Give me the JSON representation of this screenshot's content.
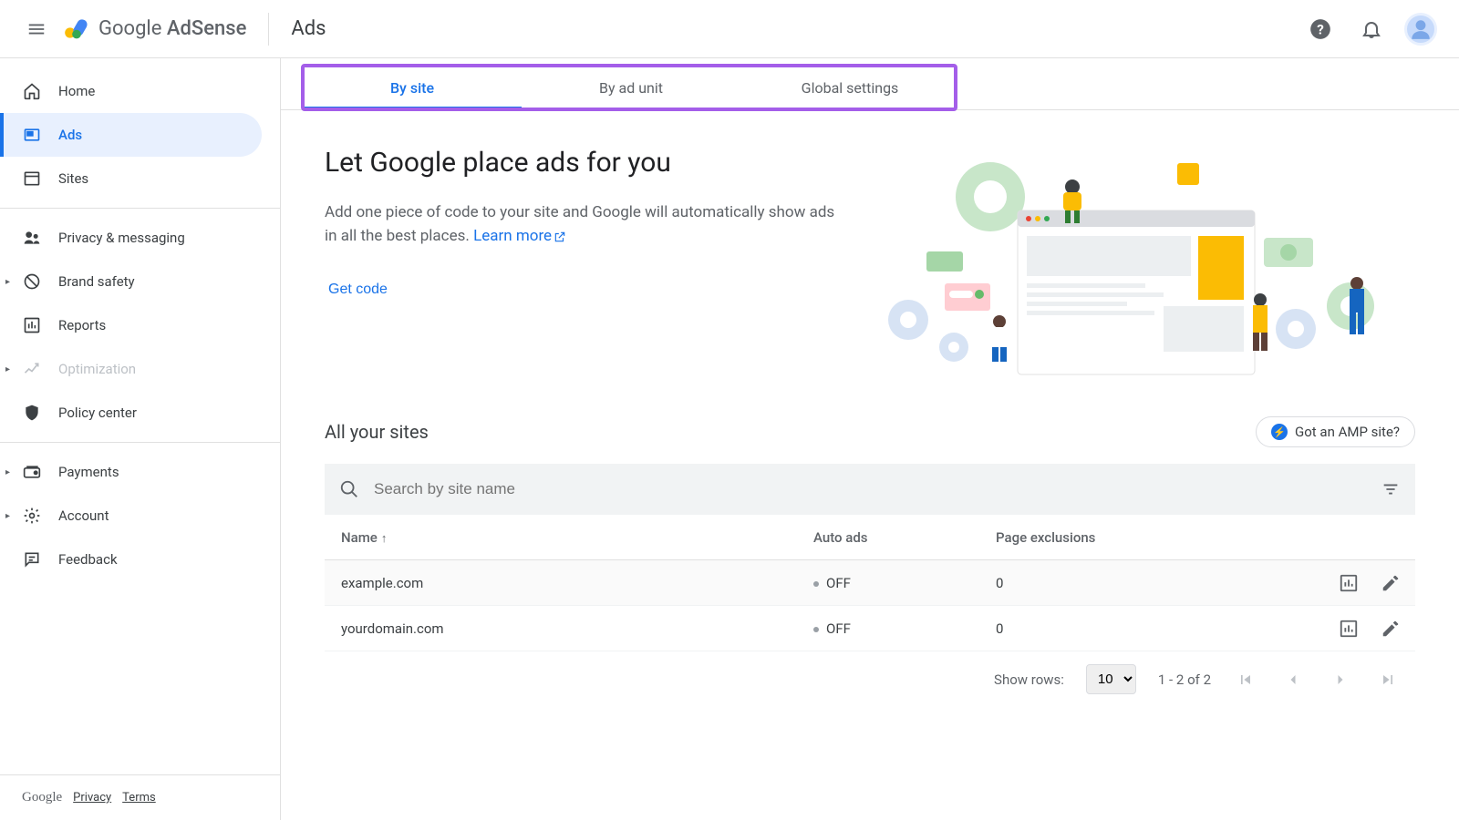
{
  "header": {
    "product_name_1": "Google",
    "product_name_2": "AdSense",
    "page_title": "Ads"
  },
  "sidebar": {
    "items": [
      {
        "label": "Home",
        "icon": "home"
      },
      {
        "label": "Ads",
        "icon": "ads",
        "active": true
      },
      {
        "label": "Sites",
        "icon": "sites"
      },
      {
        "label": "Privacy & messaging",
        "icon": "privacy"
      },
      {
        "label": "Brand safety",
        "icon": "brand",
        "expandable": true
      },
      {
        "label": "Reports",
        "icon": "reports"
      },
      {
        "label": "Optimization",
        "icon": "optim",
        "disabled": true,
        "expandable": true
      },
      {
        "label": "Policy center",
        "icon": "policy"
      },
      {
        "label": "Payments",
        "icon": "payments",
        "expandable": true
      },
      {
        "label": "Account",
        "icon": "account",
        "expandable": true
      },
      {
        "label": "Feedback",
        "icon": "feedback"
      }
    ],
    "footer_brand": "Google",
    "footer_privacy": "Privacy",
    "footer_terms": "Terms"
  },
  "tabs": [
    {
      "label": "By site",
      "active": true
    },
    {
      "label": "By ad unit"
    },
    {
      "label": "Global settings"
    }
  ],
  "hero": {
    "title": "Let Google place ads for you",
    "desc1": "Add one piece of code to your site and Google will automatically show ads in all the best places. ",
    "learn_more": "Learn more",
    "get_code": "Get code"
  },
  "sites_section": {
    "title": "All your sites",
    "amp_label": "Got an AMP site?",
    "search_placeholder": "Search by site name",
    "columns": {
      "name": "Name",
      "auto": "Auto ads",
      "excl": "Page exclusions"
    },
    "rows": [
      {
        "name": "example.com",
        "auto": "OFF",
        "excl": "0"
      },
      {
        "name": "yourdomain.com",
        "auto": "OFF",
        "excl": "0"
      }
    ],
    "pager": {
      "show_rows_label": "Show rows:",
      "rows_value": "10",
      "range": "1 - 2 of 2"
    }
  }
}
